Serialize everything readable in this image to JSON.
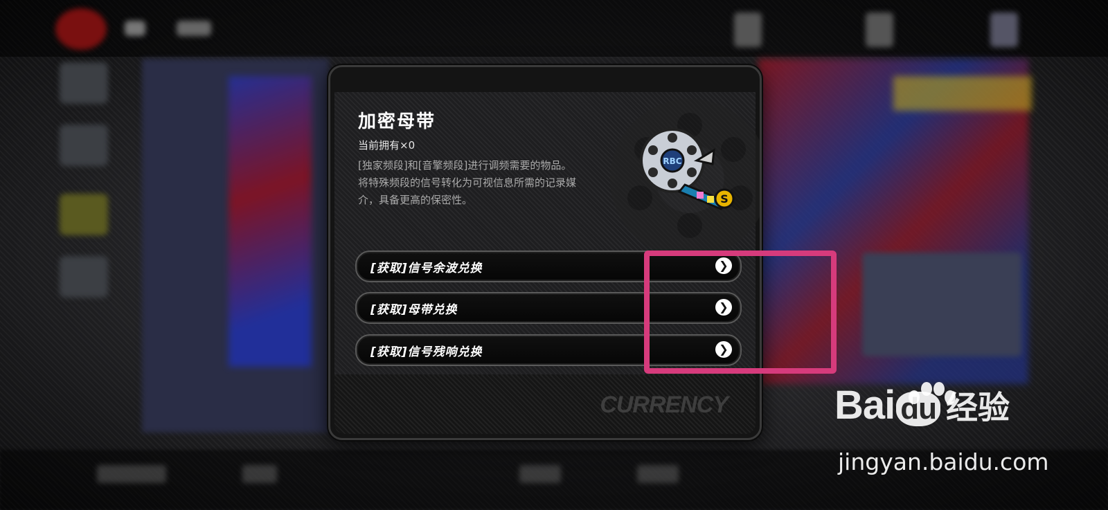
{
  "dialog": {
    "title": "加密母带",
    "owned_count": "当前拥有×0",
    "description": [
      "[独家频段]和[音擎频段]进行调频需要的物品。",
      "将特殊频段的信号转化为可视信息所需的记录媒介，具备更高的保密性。"
    ],
    "item_badge": "S",
    "item_logo_text": "RBC",
    "options": [
      {
        "label": "[获取]信号余波兑换",
        "arrow": "❯"
      },
      {
        "label": "[获取]母带兑换",
        "arrow": "❯"
      },
      {
        "label": "[获取]信号残响兑换",
        "arrow": "❯"
      }
    ],
    "footer_tag": "CURRENCY"
  },
  "watermark": {
    "brand_prefix": "Bai",
    "brand_du": "du",
    "brand_cn": "经验",
    "url": "jingyan.baidu.com"
  },
  "colors": {
    "highlight": "#d63b7c",
    "dialog_bg": "#1e1e20",
    "badge": "#e8b400"
  }
}
